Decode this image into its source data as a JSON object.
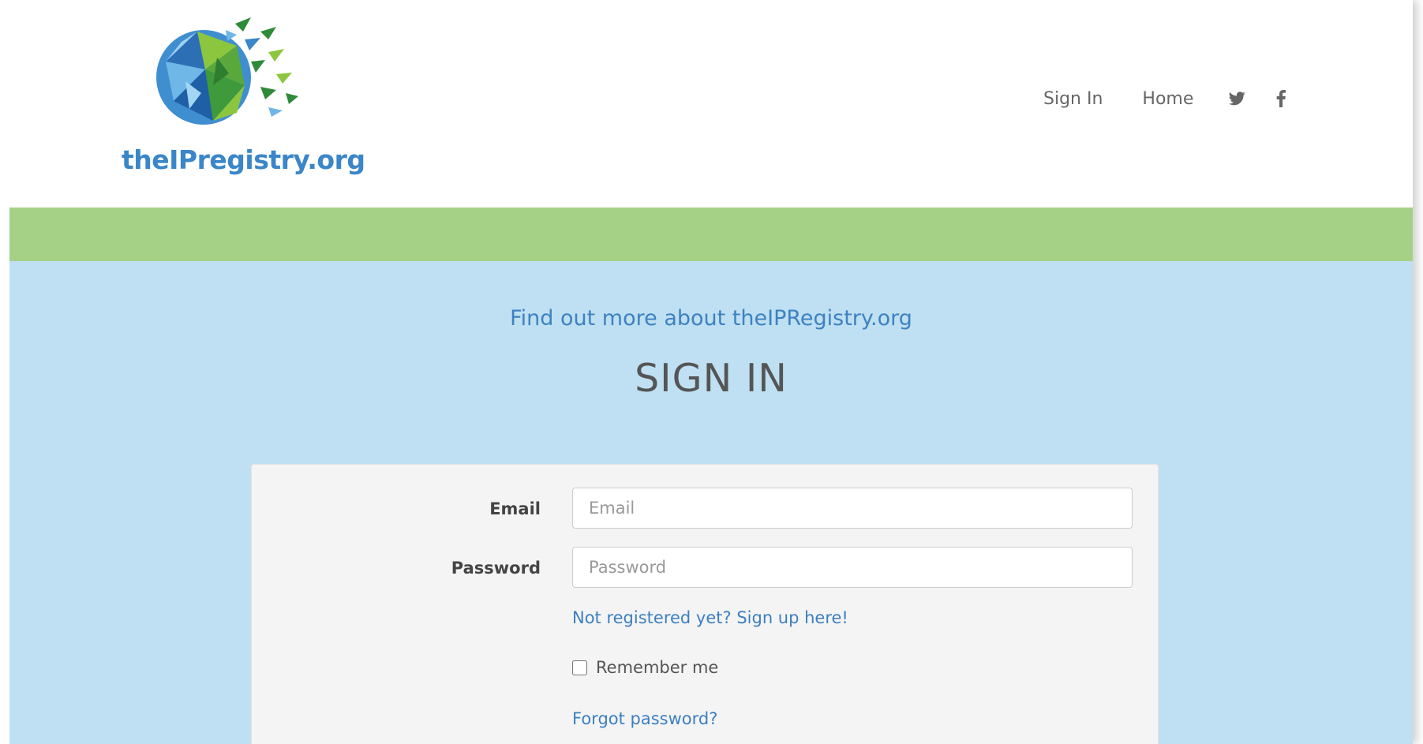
{
  "header": {
    "logo_text": "theIPregistry.org",
    "nav": {
      "sign_in": "Sign In",
      "home": "Home"
    },
    "social_icons": [
      "twitter-icon",
      "facebook-icon"
    ]
  },
  "hero": {
    "find_more_link": "Find out more about theIPRegistry.org",
    "title": "SIGN IN"
  },
  "form": {
    "email_label": "Email",
    "email_placeholder": "Email",
    "email_value": "",
    "password_label": "Password",
    "password_placeholder": "Password",
    "password_value": "",
    "signup_link": "Not registered yet? Sign up here!",
    "remember_label": "Remember me",
    "remember_checked": false,
    "forgot_link": "Forgot password?"
  },
  "colors": {
    "brand_blue": "#3a86c8",
    "link_blue": "#3d82c1",
    "band_green": "#a5d187",
    "page_blue": "#bfe0f2",
    "card_gray": "#f4f4f4"
  }
}
